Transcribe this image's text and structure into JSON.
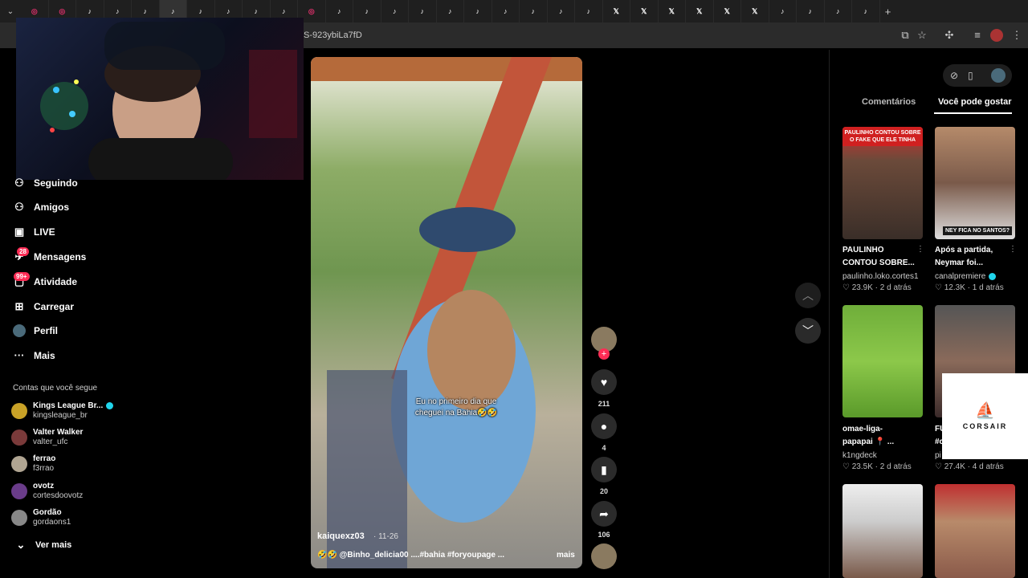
{
  "browser": {
    "url": "S-923ybiLa7fD"
  },
  "sidebar": {
    "items": [
      {
        "label": "Seguindo",
        "icon": "following-icon"
      },
      {
        "label": "Amigos",
        "icon": "friends-icon"
      },
      {
        "label": "LIVE",
        "icon": "live-icon"
      },
      {
        "label": "Mensagens",
        "icon": "messages-icon",
        "badge": "28"
      },
      {
        "label": "Atividade",
        "icon": "activity-icon",
        "badge": "99+"
      },
      {
        "label": "Carregar",
        "icon": "upload-icon"
      },
      {
        "label": "Perfil",
        "icon": "profile-icon"
      },
      {
        "label": "Mais",
        "icon": "more-icon"
      }
    ],
    "following_title": "Contas que você segue",
    "accounts": [
      {
        "name": "Kings League Br...",
        "handle": "kingsleague_br",
        "verified": true,
        "color": "#c9a227"
      },
      {
        "name": "Valter Walker",
        "handle": "valter_ufc",
        "verified": false,
        "color": "#7a3a3a"
      },
      {
        "name": "ferrao",
        "handle": "f3rrao",
        "verified": false,
        "color": "#b0a592"
      },
      {
        "name": "ovotz",
        "handle": "cortesdoovotz",
        "verified": false,
        "color": "#6a3c8a"
      },
      {
        "name": "Gordão",
        "handle": "gordaons1",
        "verified": false,
        "color": "#888888"
      }
    ],
    "see_more": "Ver mais"
  },
  "video": {
    "caption_line1": "Eu no primeiro dia que",
    "caption_line2": "cheguei na Bahia🤣🤣",
    "username": "kaiquexz03",
    "date": "· 11-26",
    "description": "🤣🤣 @Binho_delicia00 ....#bahia #foryoupage ...",
    "more": "mais",
    "likes": "211",
    "comments": "4",
    "saves": "20",
    "shares": "106"
  },
  "right_panel": {
    "tabs": [
      "Comentários",
      "Você pode gostar"
    ],
    "active_tab": "Você pode gostar",
    "recommendations": [
      {
        "title_line1": "PAULINHO",
        "title_line2": "CONTOU SOBRE...",
        "author": "paulinho.loko.cortes1",
        "likes": "23.9K",
        "age": "2 d atrás",
        "overlay": "PAULINHO CONTOU SOBRE O FAKE QUE ELE TINHA",
        "verified": false
      },
      {
        "title_line1": "Após a partida,",
        "title_line2": "Neymar foi...",
        "author": "canalpremiere",
        "likes": "12.3K",
        "age": "1 d atrás",
        "overlay": "NEY FICA NO SANTOS?",
        "verified": true
      },
      {
        "title_line1": "omae-liga-",
        "title_line2": "papapai 📍 ...",
        "author": "k1ngdeck",
        "likes": "23.5K",
        "age": "2 d atrás",
        "overlay": "",
        "verified": false
      },
      {
        "title_line1": "FU",
        "title_line2": "#c",
        "author": "pi",
        "likes": "27.4K",
        "age": "4 d atrás",
        "overlay": "",
        "verified": false
      }
    ]
  },
  "ad": {
    "brand": "CORSAIR"
  }
}
